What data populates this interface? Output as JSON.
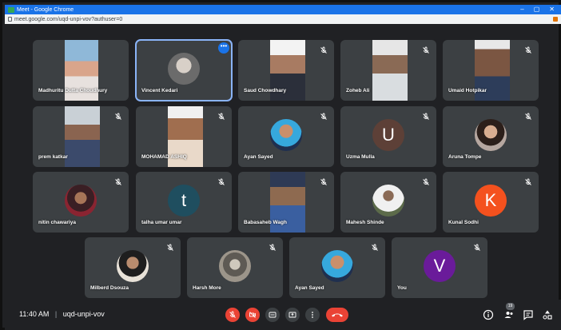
{
  "browser": {
    "title": "Meet - Google Chrome",
    "url": "meet.google.com/uqd-unpi-vov?authuser=0",
    "minimize": "–",
    "maximize": "▢",
    "close": "✕"
  },
  "participants": [
    {
      "name": "Madhuritu Dutta Choudhury"
    },
    {
      "name": "Vincent Kedari"
    },
    {
      "name": "Saud Chowdhary"
    },
    {
      "name": "Zoheb Ali"
    },
    {
      "name": "Umaid Hotpikar"
    },
    {
      "name": "prem katkar"
    },
    {
      "name": "MOHAMAD ASHIQ"
    },
    {
      "name": "Ayan Sayed"
    },
    {
      "name": "Uzma Mulla",
      "initial": "U",
      "color": "#5d4037"
    },
    {
      "name": "Aruna Tompe"
    },
    {
      "name": "nitin chawariya"
    },
    {
      "name": "talha umar umar",
      "initial": "t",
      "color": "#1f4e5f"
    },
    {
      "name": "Babasaheb Wagh"
    },
    {
      "name": "Mahesh Shinde"
    },
    {
      "name": "Kunal Sodhi",
      "initial": "K",
      "color": "#f4511e"
    },
    {
      "name": "Milberd Dsouza"
    },
    {
      "name": "Harsh More"
    },
    {
      "name": "Ayan Sayed"
    },
    {
      "name": "You",
      "initial": "V",
      "color": "#6a1b9a"
    }
  ],
  "tile_more_label": "•••",
  "bottom_bar": {
    "time": "11:40 AM",
    "separator": "|",
    "meeting_code": "uqd-unpi-vov",
    "participant_count": "19"
  },
  "colors": {
    "background": "#202124",
    "tile": "#3c4043",
    "danger": "#ea4335",
    "accent": "#1a73e8"
  }
}
